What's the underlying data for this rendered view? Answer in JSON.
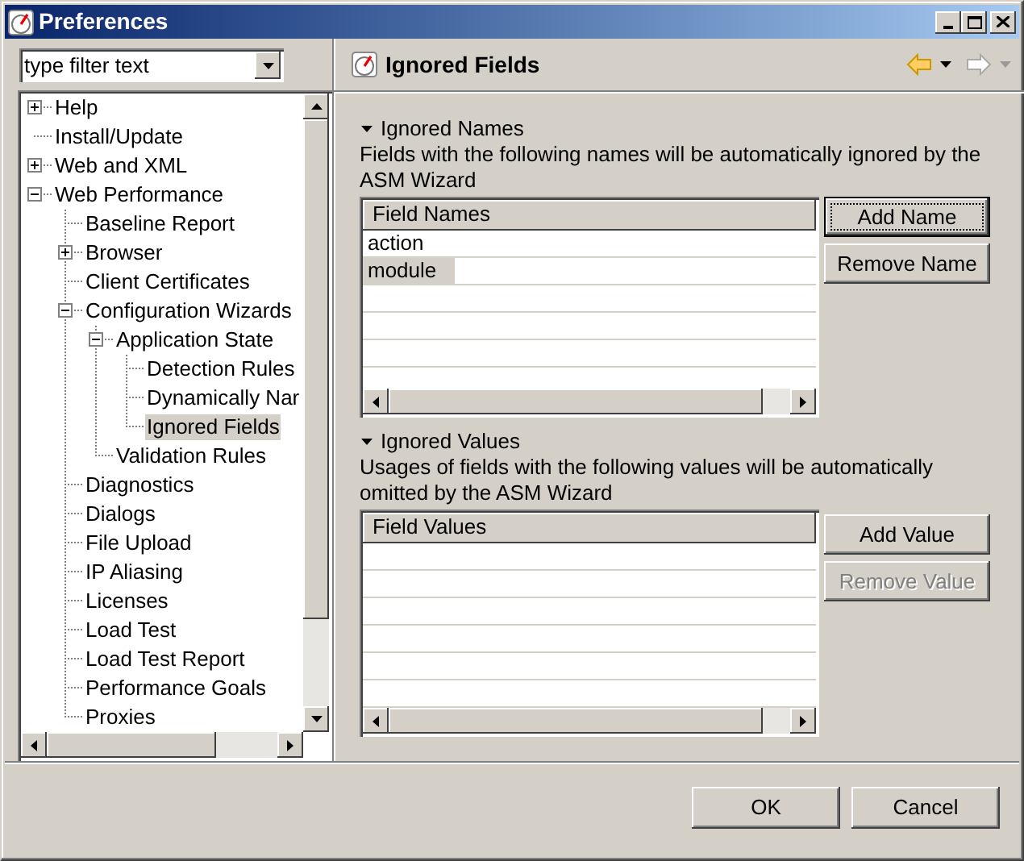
{
  "window": {
    "title": "Preferences"
  },
  "filter": {
    "placeholder": "type filter text"
  },
  "tree": [
    {
      "label": "Help",
      "kind": "node",
      "expanded": false,
      "selected": false
    },
    {
      "label": "Install/Update",
      "kind": "leaf",
      "selected": false
    },
    {
      "label": "Web and XML",
      "kind": "node",
      "expanded": false,
      "selected": false
    },
    {
      "label": "Web Performance",
      "kind": "node",
      "expanded": true,
      "selected": false,
      "children": [
        {
          "label": "Baseline Report",
          "kind": "leaf",
          "selected": false
        },
        {
          "label": "Browser",
          "kind": "node",
          "expanded": false,
          "selected": false
        },
        {
          "label": "Client Certificates",
          "kind": "leaf",
          "selected": false
        },
        {
          "label": "Configuration Wizards",
          "kind": "node",
          "expanded": true,
          "selected": false,
          "children": [
            {
              "label": "Application State",
              "kind": "node",
              "expanded": true,
              "selected": false,
              "children": [
                {
                  "label": "Detection Rules",
                  "kind": "leaf",
                  "selected": false
                },
                {
                  "label": "Dynamically Nar",
                  "kind": "leaf",
                  "selected": false
                },
                {
                  "label": "Ignored Fields",
                  "kind": "leaf",
                  "selected": true
                }
              ]
            },
            {
              "label": "Validation Rules",
              "kind": "leaf",
              "selected": false
            }
          ]
        },
        {
          "label": "Diagnostics",
          "kind": "leaf",
          "selected": false
        },
        {
          "label": "Dialogs",
          "kind": "leaf",
          "selected": false
        },
        {
          "label": "File Upload",
          "kind": "leaf",
          "selected": false
        },
        {
          "label": "IP Aliasing",
          "kind": "leaf",
          "selected": false
        },
        {
          "label": "Licenses",
          "kind": "leaf",
          "selected": false
        },
        {
          "label": "Load Test",
          "kind": "leaf",
          "selected": false
        },
        {
          "label": "Load Test Report",
          "kind": "leaf",
          "selected": false
        },
        {
          "label": "Performance Goals",
          "kind": "leaf",
          "selected": false
        },
        {
          "label": "Proxies",
          "kind": "leaf",
          "selected": false
        }
      ]
    }
  ],
  "page": {
    "title": "Ignored Fields"
  },
  "sections": [
    {
      "title": "Ignored Names",
      "expanded": true,
      "description": "Fields with the following names will be automatically ignored by the ASM Wizard",
      "column": "Field Names",
      "rows": [
        {
          "text": "action",
          "selected": false
        },
        {
          "text": "module",
          "selected": true
        }
      ],
      "buttons": [
        {
          "label": "Add Name",
          "default": true,
          "disabled": false
        },
        {
          "label": "Remove Name",
          "default": false,
          "disabled": false
        }
      ]
    },
    {
      "title": "Ignored Values",
      "expanded": true,
      "description": "Usages of fields with the following values will be automatically omitted by the ASM Wizard",
      "column": "Field Values",
      "buttons": [
        {
          "label": "Add Value",
          "default": false,
          "disabled": false
        },
        {
          "label": "Remove Value",
          "default": false,
          "disabled": true
        }
      ]
    }
  ],
  "buttons": [
    "OK",
    "Cancel"
  ]
}
